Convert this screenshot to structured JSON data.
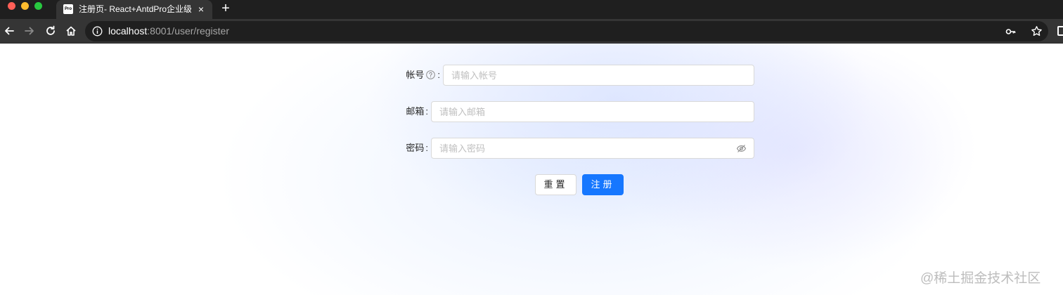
{
  "browser": {
    "tab": {
      "favicon_text": "Pro",
      "title": "注册页- React+AntdPro企业级项",
      "close_label": "×"
    },
    "new_tab_label": "+",
    "url": {
      "host": "localhost",
      "rest": ":8001/user/register"
    },
    "icons": [
      "back-icon",
      "forward-icon",
      "reload-icon",
      "home-icon",
      "info-icon",
      "key-icon",
      "star-icon",
      "extensions-icon"
    ]
  },
  "form": {
    "account": {
      "label": "帐号",
      "colon": ":",
      "placeholder": "请输入帐号",
      "help_icon": "question-circle-icon"
    },
    "email": {
      "label": "邮箱",
      "colon": ":",
      "placeholder": "请输入邮箱"
    },
    "password": {
      "label": "密码",
      "colon": ":",
      "placeholder": "请输入密码",
      "visibility_icon": "eye-invisible-icon"
    },
    "reset_label": "重置",
    "submit_label": "注册"
  },
  "colors": {
    "primary": "#1677ff",
    "chrome_dark": "#1f1f1f",
    "chrome_mid": "#353535"
  },
  "watermark": "@稀土掘金技术社区"
}
